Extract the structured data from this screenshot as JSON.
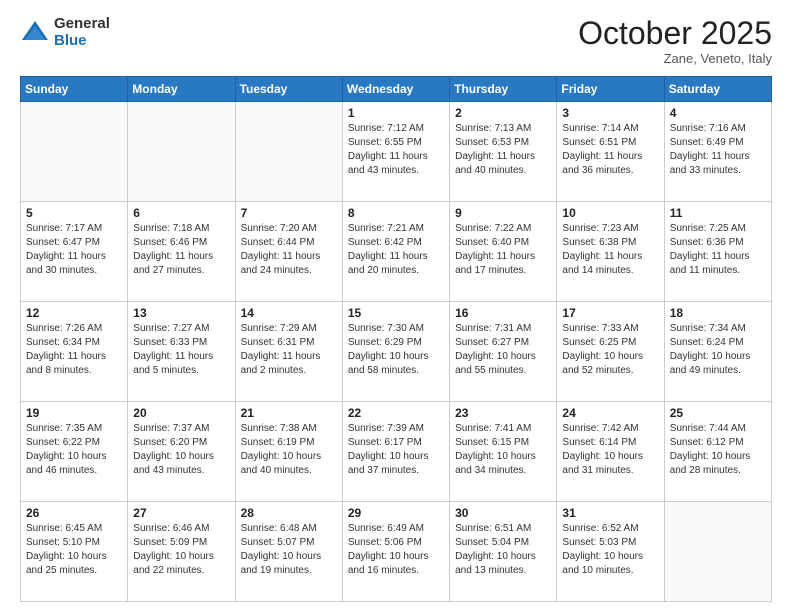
{
  "logo": {
    "general": "General",
    "blue": "Blue"
  },
  "header": {
    "month": "October 2025",
    "location": "Zane, Veneto, Italy"
  },
  "days_of_week": [
    "Sunday",
    "Monday",
    "Tuesday",
    "Wednesday",
    "Thursday",
    "Friday",
    "Saturday"
  ],
  "weeks": [
    [
      {
        "day": "",
        "info": ""
      },
      {
        "day": "",
        "info": ""
      },
      {
        "day": "",
        "info": ""
      },
      {
        "day": "1",
        "info": "Sunrise: 7:12 AM\nSunset: 6:55 PM\nDaylight: 11 hours and 43 minutes."
      },
      {
        "day": "2",
        "info": "Sunrise: 7:13 AM\nSunset: 6:53 PM\nDaylight: 11 hours and 40 minutes."
      },
      {
        "day": "3",
        "info": "Sunrise: 7:14 AM\nSunset: 6:51 PM\nDaylight: 11 hours and 36 minutes."
      },
      {
        "day": "4",
        "info": "Sunrise: 7:16 AM\nSunset: 6:49 PM\nDaylight: 11 hours and 33 minutes."
      }
    ],
    [
      {
        "day": "5",
        "info": "Sunrise: 7:17 AM\nSunset: 6:47 PM\nDaylight: 11 hours and 30 minutes."
      },
      {
        "day": "6",
        "info": "Sunrise: 7:18 AM\nSunset: 6:46 PM\nDaylight: 11 hours and 27 minutes."
      },
      {
        "day": "7",
        "info": "Sunrise: 7:20 AM\nSunset: 6:44 PM\nDaylight: 11 hours and 24 minutes."
      },
      {
        "day": "8",
        "info": "Sunrise: 7:21 AM\nSunset: 6:42 PM\nDaylight: 11 hours and 20 minutes."
      },
      {
        "day": "9",
        "info": "Sunrise: 7:22 AM\nSunset: 6:40 PM\nDaylight: 11 hours and 17 minutes."
      },
      {
        "day": "10",
        "info": "Sunrise: 7:23 AM\nSunset: 6:38 PM\nDaylight: 11 hours and 14 minutes."
      },
      {
        "day": "11",
        "info": "Sunrise: 7:25 AM\nSunset: 6:36 PM\nDaylight: 11 hours and 11 minutes."
      }
    ],
    [
      {
        "day": "12",
        "info": "Sunrise: 7:26 AM\nSunset: 6:34 PM\nDaylight: 11 hours and 8 minutes."
      },
      {
        "day": "13",
        "info": "Sunrise: 7:27 AM\nSunset: 6:33 PM\nDaylight: 11 hours and 5 minutes."
      },
      {
        "day": "14",
        "info": "Sunrise: 7:29 AM\nSunset: 6:31 PM\nDaylight: 11 hours and 2 minutes."
      },
      {
        "day": "15",
        "info": "Sunrise: 7:30 AM\nSunset: 6:29 PM\nDaylight: 10 hours and 58 minutes."
      },
      {
        "day": "16",
        "info": "Sunrise: 7:31 AM\nSunset: 6:27 PM\nDaylight: 10 hours and 55 minutes."
      },
      {
        "day": "17",
        "info": "Sunrise: 7:33 AM\nSunset: 6:25 PM\nDaylight: 10 hours and 52 minutes."
      },
      {
        "day": "18",
        "info": "Sunrise: 7:34 AM\nSunset: 6:24 PM\nDaylight: 10 hours and 49 minutes."
      }
    ],
    [
      {
        "day": "19",
        "info": "Sunrise: 7:35 AM\nSunset: 6:22 PM\nDaylight: 10 hours and 46 minutes."
      },
      {
        "day": "20",
        "info": "Sunrise: 7:37 AM\nSunset: 6:20 PM\nDaylight: 10 hours and 43 minutes."
      },
      {
        "day": "21",
        "info": "Sunrise: 7:38 AM\nSunset: 6:19 PM\nDaylight: 10 hours and 40 minutes."
      },
      {
        "day": "22",
        "info": "Sunrise: 7:39 AM\nSunset: 6:17 PM\nDaylight: 10 hours and 37 minutes."
      },
      {
        "day": "23",
        "info": "Sunrise: 7:41 AM\nSunset: 6:15 PM\nDaylight: 10 hours and 34 minutes."
      },
      {
        "day": "24",
        "info": "Sunrise: 7:42 AM\nSunset: 6:14 PM\nDaylight: 10 hours and 31 minutes."
      },
      {
        "day": "25",
        "info": "Sunrise: 7:44 AM\nSunset: 6:12 PM\nDaylight: 10 hours and 28 minutes."
      }
    ],
    [
      {
        "day": "26",
        "info": "Sunrise: 6:45 AM\nSunset: 5:10 PM\nDaylight: 10 hours and 25 minutes."
      },
      {
        "day": "27",
        "info": "Sunrise: 6:46 AM\nSunset: 5:09 PM\nDaylight: 10 hours and 22 minutes."
      },
      {
        "day": "28",
        "info": "Sunrise: 6:48 AM\nSunset: 5:07 PM\nDaylight: 10 hours and 19 minutes."
      },
      {
        "day": "29",
        "info": "Sunrise: 6:49 AM\nSunset: 5:06 PM\nDaylight: 10 hours and 16 minutes."
      },
      {
        "day": "30",
        "info": "Sunrise: 6:51 AM\nSunset: 5:04 PM\nDaylight: 10 hours and 13 minutes."
      },
      {
        "day": "31",
        "info": "Sunrise: 6:52 AM\nSunset: 5:03 PM\nDaylight: 10 hours and 10 minutes."
      },
      {
        "day": "",
        "info": ""
      }
    ]
  ]
}
